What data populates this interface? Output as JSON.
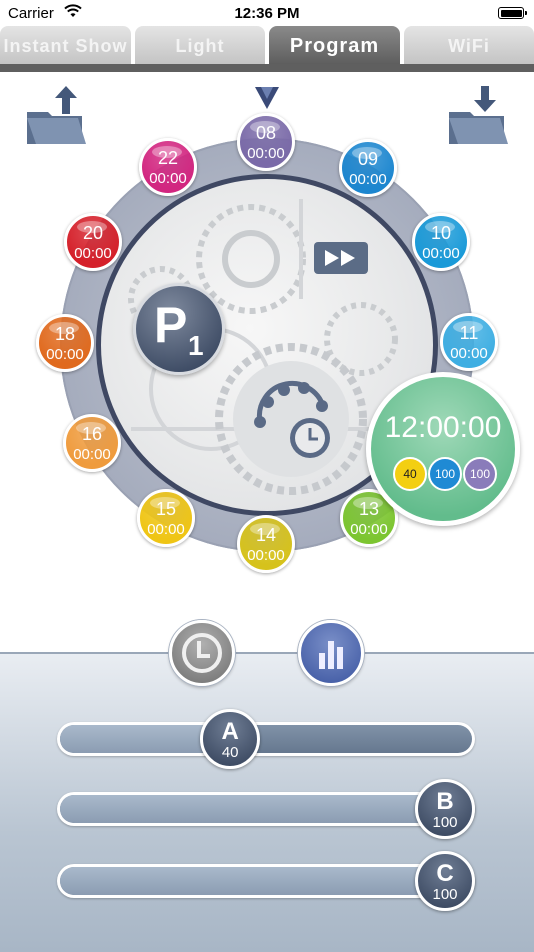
{
  "status_bar": {
    "carrier": "Carrier",
    "time": "12:36 PM"
  },
  "tabs": [
    {
      "label": "Instant Show",
      "active": false
    },
    {
      "label": "Light",
      "active": false
    },
    {
      "label": "Program",
      "active": true
    },
    {
      "label": "WiFi",
      "active": false
    }
  ],
  "toolbar": {
    "upload_icon": "folder-upload-icon",
    "download_icon": "folder-download-icon"
  },
  "dial": {
    "program_label": "P",
    "program_number": "1",
    "hours": [
      {
        "hour": "08",
        "time": "00:00",
        "color": "#7a6aa8"
      },
      {
        "hour": "09",
        "time": "00:00",
        "color": "#1c86cf"
      },
      {
        "hour": "10",
        "time": "00:00",
        "color": "#1a9ad8"
      },
      {
        "hour": "11",
        "time": "00:00",
        "color": "#3eaee2"
      },
      {
        "hour": "13",
        "time": "00:00",
        "color": "#7cc530"
      },
      {
        "hour": "14",
        "time": "00:00",
        "color": "#d6c21c"
      },
      {
        "hour": "15",
        "time": "00:00",
        "color": "#efc515"
      },
      {
        "hour": "16",
        "time": "00:00",
        "color": "#ef9b3d"
      },
      {
        "hour": "18",
        "time": "00:00",
        "color": "#e06a1e"
      },
      {
        "hour": "20",
        "time": "00:00",
        "color": "#d5202a"
      },
      {
        "hour": "22",
        "time": "00:00",
        "color": "#d22680"
      }
    ]
  },
  "selected_time": {
    "time": "12:00:00",
    "channels": [
      {
        "value": "40",
        "color": "#f3cf12",
        "text_color": "#222222"
      },
      {
        "value": "100",
        "color": "#1f8ad4",
        "text_color": "#ffffff"
      },
      {
        "value": "100",
        "color": "#8a7cba",
        "text_color": "#ffffff"
      }
    ]
  },
  "mode_buttons": {
    "clock_icon": "clock-icon",
    "chart_icon": "bar-chart-icon"
  },
  "sliders": [
    {
      "label": "A",
      "value": "40",
      "level": 0.4
    },
    {
      "label": "B",
      "value": "100",
      "level": 1.0
    },
    {
      "label": "C",
      "value": "100",
      "level": 1.0
    }
  ]
}
